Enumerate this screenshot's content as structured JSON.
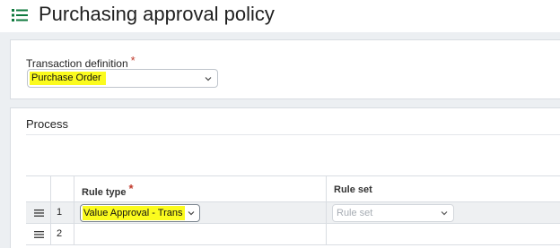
{
  "header": {
    "title": "Purchasing approval policy",
    "menu_icon": "list-menu-icon"
  },
  "transaction": {
    "label": "Transaction definition",
    "required_mark": "*",
    "value": "Purchase Order"
  },
  "process": {
    "title": "Process",
    "columns": [
      {
        "label": "Rule type",
        "required_mark": "*"
      },
      {
        "label": "Rule set"
      }
    ],
    "rows": [
      {
        "number": "1",
        "rule_type": "Value Approval - Trans",
        "rule_set_placeholder": "Rule set"
      },
      {
        "number": "2"
      }
    ]
  },
  "colors": {
    "highlight": "#fbfb1e",
    "brand_green": "#0f7a3e",
    "required": "#c0392b"
  }
}
